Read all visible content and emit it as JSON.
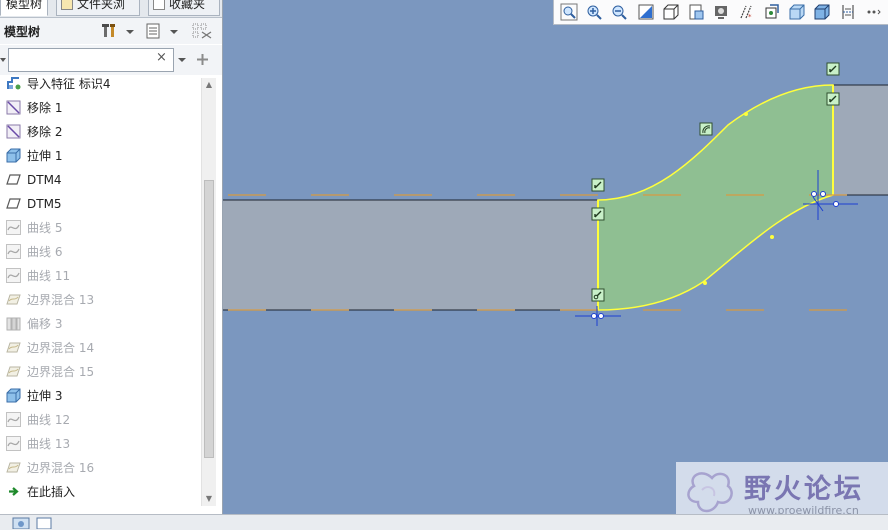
{
  "tabs": [
    {
      "label": "模型树",
      "icon": "model-tree-icon"
    },
    {
      "label": "文件夹浏",
      "icon": "folder-icon"
    },
    {
      "label": "收藏夹",
      "icon": "favorites-star-icon"
    }
  ],
  "tree_header": {
    "title": "模型树"
  },
  "search": {
    "value": "",
    "clear_label": "×"
  },
  "tree_items": [
    {
      "label": "导入特征 标识4",
      "icon": "import-feature-icon",
      "dimmed": false
    },
    {
      "label": "移除 1",
      "icon": "remove-icon",
      "dimmed": false
    },
    {
      "label": "移除 2",
      "icon": "remove-icon",
      "dimmed": false
    },
    {
      "label": "拉伸 1",
      "icon": "extrude-icon",
      "dimmed": false
    },
    {
      "label": "DTM4",
      "icon": "datum-plane-icon",
      "dimmed": false
    },
    {
      "label": "DTM5",
      "icon": "datum-plane-icon",
      "dimmed": false
    },
    {
      "label": "曲线 5",
      "icon": "curve-icon",
      "dimmed": true
    },
    {
      "label": "曲线 6",
      "icon": "curve-icon",
      "dimmed": true
    },
    {
      "label": "曲线 11",
      "icon": "curve-icon",
      "dimmed": true
    },
    {
      "label": "边界混合 13",
      "icon": "boundary-blend-icon",
      "dimmed": true
    },
    {
      "label": "偏移 3",
      "icon": "offset-icon",
      "dimmed": true
    },
    {
      "label": "边界混合 14",
      "icon": "boundary-blend-icon",
      "dimmed": true
    },
    {
      "label": "边界混合 15",
      "icon": "boundary-blend-icon",
      "dimmed": true
    },
    {
      "label": "拉伸 3",
      "icon": "extrude-icon",
      "dimmed": false
    },
    {
      "label": "曲线 12",
      "icon": "curve-icon",
      "dimmed": true
    },
    {
      "label": "曲线 13",
      "icon": "curve-icon",
      "dimmed": true
    },
    {
      "label": "边界混合 16",
      "icon": "boundary-blend-icon",
      "dimmed": true
    },
    {
      "label": "在此插入",
      "icon": "insert-here-arrow-icon",
      "dimmed": false
    }
  ],
  "view_toolbar": [
    "zoom-fit-icon",
    "zoom-in-icon",
    "zoom-out-icon",
    "repaint-icon",
    "saved-orientations-icon",
    "named-views-icon",
    "display-style-icon",
    "datum-display-icon",
    "spin-center-icon",
    "shading-icon",
    "shading-edges-icon",
    "annotation-display-icon",
    "more-icon"
  ],
  "watermark": {
    "title": "野火论坛",
    "url": "www.proewildfire.cn"
  },
  "colors": {
    "viewport_bg": "#7b97bf",
    "part_gray": "#9ea9b8",
    "blend_green": "#8fbf92",
    "edge_yellow": "#ffff3c",
    "datum_orange": "#d79a42",
    "handle_green": "#c8f0c8"
  }
}
